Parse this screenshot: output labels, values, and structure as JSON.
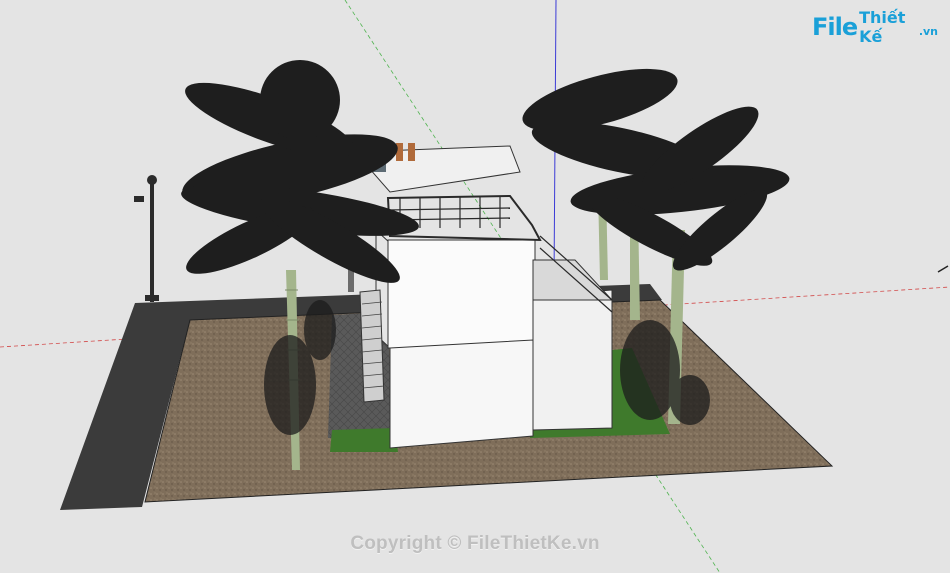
{
  "watermark": {
    "logo_file": "File",
    "logo_rest": "Thiết Kế",
    "logo_suffix": ".vn",
    "copyright": "Copyright © FileThietKe.vn"
  },
  "colors": {
    "background": "#e4e4e4",
    "ground": "#7d6c58",
    "road": "#3b3b3b",
    "lawn": "#3f7a2c",
    "building": "#f4f4f4",
    "axis_red": "#d24a4a",
    "axis_green": "#4fb34f",
    "axis_blue": "#3b3bd6",
    "brand": "#1aa0d8"
  },
  "scene": {
    "model": "two-storey villa with palm trees",
    "axes": [
      "red",
      "green",
      "blue"
    ]
  }
}
